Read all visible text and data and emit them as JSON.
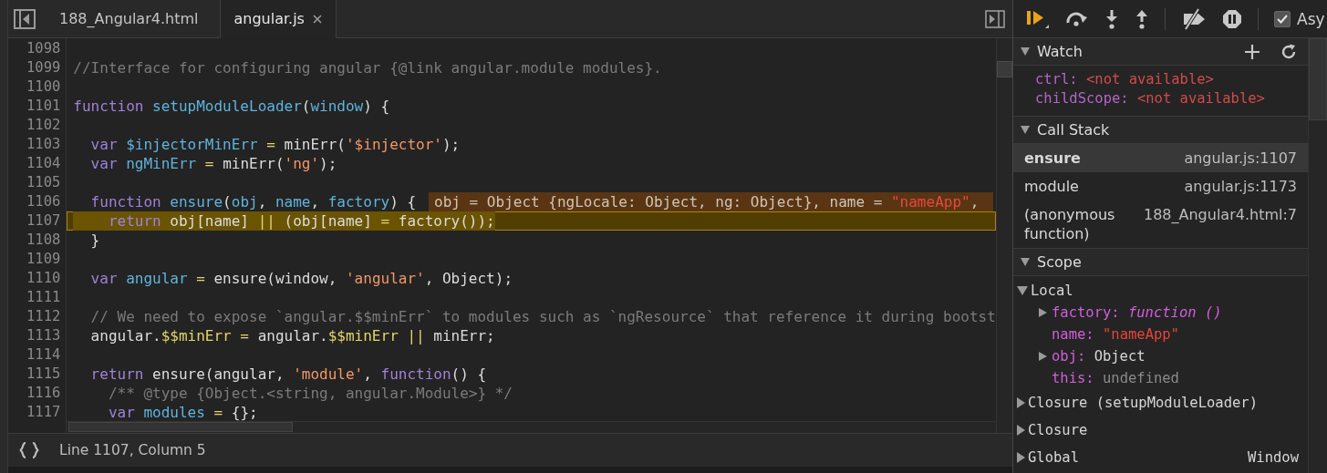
{
  "editor": {
    "tabs": [
      {
        "label": "188_Angular4.html",
        "selected": false,
        "closable": false
      },
      {
        "label": "angular.js",
        "selected": true,
        "closable": true
      }
    ],
    "lines": [
      {
        "number": "1098",
        "current": false
      },
      {
        "number": "1099",
        "current": false,
        "tokens": [
          {
            "kind": "comment",
            "text": "//Interface for configuring angular {@link angular.module modules}."
          }
        ]
      },
      {
        "number": "1100",
        "current": false
      },
      {
        "number": "1101",
        "current": false,
        "tokens": [
          {
            "kind": "keyword",
            "text": "function"
          },
          {
            "kind": "definition",
            "text": " setupModuleLoader"
          },
          {
            "kind": "plain",
            "text": "("
          },
          {
            "kind": "definition",
            "text": "window"
          },
          {
            "kind": "plain",
            "text": ") {"
          }
        ]
      },
      {
        "number": "1102",
        "current": false
      },
      {
        "number": "1103",
        "current": false,
        "tokens": [
          {
            "kind": "keyword",
            "text": "  var"
          },
          {
            "kind": "definition",
            "text": " $injectorMinErr"
          },
          {
            "kind": "operator",
            "text": " = "
          },
          {
            "kind": "plain",
            "text": "minErr("
          },
          {
            "kind": "string",
            "text": "'$injector'"
          },
          {
            "kind": "plain",
            "text": ");"
          }
        ]
      },
      {
        "number": "1104",
        "current": false,
        "tokens": [
          {
            "kind": "keyword",
            "text": "  var"
          },
          {
            "kind": "definition",
            "text": " ngMinErr"
          },
          {
            "kind": "operator",
            "text": " = "
          },
          {
            "kind": "plain",
            "text": "minErr("
          },
          {
            "kind": "string",
            "text": "'ng'"
          },
          {
            "kind": "plain",
            "text": ");"
          }
        ]
      },
      {
        "number": "1105",
        "current": false
      },
      {
        "number": "1106",
        "current": false,
        "tokens": [
          {
            "kind": "keyword",
            "text": "  function"
          },
          {
            "kind": "definition",
            "text": " ensure"
          },
          {
            "kind": "plain",
            "text": "("
          },
          {
            "kind": "definition",
            "text": "obj"
          },
          {
            "kind": "plain",
            "text": ", "
          },
          {
            "kind": "definition",
            "text": "name"
          },
          {
            "kind": "plain",
            "text": ", "
          },
          {
            "kind": "definition",
            "text": "factory"
          },
          {
            "kind": "plain",
            "text": ") {"
          }
        ],
        "inline_value": [
          {
            "kind": "plain",
            "text": "obj = Object {ngLocale: Object, ng: Object}, name = "
          },
          {
            "kind": "value_string",
            "text": "\"nameApp\""
          },
          {
            "kind": "plain",
            "text": ", "
          }
        ]
      },
      {
        "number": "1107",
        "current": true,
        "tokens": [
          {
            "kind": "keyword",
            "text": "    return"
          },
          {
            "kind": "plain",
            "text": " obj[name] "
          },
          {
            "kind": "operator",
            "text": "||"
          },
          {
            "kind": "plain",
            "text": " (obj[name] "
          },
          {
            "kind": "operator",
            "text": "="
          },
          {
            "kind": "plain",
            "text": " factory());"
          }
        ]
      },
      {
        "number": "1108",
        "current": false,
        "tokens": [
          {
            "kind": "plain",
            "text": "  }"
          }
        ]
      },
      {
        "number": "1109",
        "current": false
      },
      {
        "number": "1110",
        "current": false,
        "tokens": [
          {
            "kind": "keyword",
            "text": "  var"
          },
          {
            "kind": "definition",
            "text": " angular"
          },
          {
            "kind": "operator",
            "text": " = "
          },
          {
            "kind": "plain",
            "text": "ensure(window, "
          },
          {
            "kind": "string",
            "text": "'angular'"
          },
          {
            "kind": "plain",
            "text": ", Object);"
          }
        ]
      },
      {
        "number": "1111",
        "current": false
      },
      {
        "number": "1112",
        "current": false,
        "tokens": [
          {
            "kind": "comment",
            "text": "  // We need to expose `angular.$$minErr` to modules such as `ngResource` that reference it during bootst"
          }
        ]
      },
      {
        "number": "1113",
        "current": false,
        "tokens": [
          {
            "kind": "plain",
            "text": "  angular."
          },
          {
            "kind": "property",
            "text": "$$minErr"
          },
          {
            "kind": "operator",
            "text": " = "
          },
          {
            "kind": "plain",
            "text": "angular."
          },
          {
            "kind": "property",
            "text": "$$minErr"
          },
          {
            "kind": "operator",
            "text": " || "
          },
          {
            "kind": "plain",
            "text": "minErr;"
          }
        ]
      },
      {
        "number": "1114",
        "current": false
      },
      {
        "number": "1115",
        "current": false,
        "tokens": [
          {
            "kind": "keyword",
            "text": "  return"
          },
          {
            "kind": "plain",
            "text": " ensure(angular, "
          },
          {
            "kind": "string",
            "text": "'module'"
          },
          {
            "kind": "plain",
            "text": ", "
          },
          {
            "kind": "keyword",
            "text": "function"
          },
          {
            "kind": "plain",
            "text": "() {"
          }
        ]
      },
      {
        "number": "1116",
        "current": false,
        "tokens": [
          {
            "kind": "comment",
            "text": "    /** @type {Object.<string, angular.Module>} */"
          }
        ]
      },
      {
        "number": "1117",
        "current": false,
        "tokens": [
          {
            "kind": "keyword",
            "text": "    var"
          },
          {
            "kind": "definition",
            "text": " modules"
          },
          {
            "kind": "operator",
            "text": " = "
          },
          {
            "kind": "plain",
            "text": "{};"
          }
        ]
      }
    ],
    "status_bar": {
      "position": "Line 1107, Column 5"
    }
  },
  "debugger": {
    "toolbar": {
      "async": {
        "label": "Asy",
        "checked": true
      }
    },
    "watch": {
      "title": "Watch",
      "expanded": true,
      "items": [
        {
          "name": "ctrl:",
          "value": "<not available>"
        },
        {
          "name": "childScope:",
          "value": "<not available>"
        }
      ]
    },
    "call_stack": {
      "title": "Call Stack",
      "expanded": true,
      "frames": [
        {
          "function": "ensure",
          "location": "angular.js:1107",
          "selected": true
        },
        {
          "function": "module",
          "location": "angular.js:1173",
          "selected": false
        },
        {
          "function": "(anonymous function)",
          "location": "188_Angular4.html:7",
          "selected": false
        }
      ]
    },
    "scope": {
      "title": "Scope",
      "expanded": true,
      "tree": [
        {
          "label": "Local",
          "expanded": true,
          "children": [
            {
              "name": "factory:",
              "value": "function ()",
              "kind": "function",
              "expandable": true
            },
            {
              "name": "name:",
              "value": "\"nameApp\"",
              "kind": "string",
              "expandable": false
            },
            {
              "name": "obj:",
              "value": "Object",
              "kind": "object",
              "expandable": true
            },
            {
              "name": "this:",
              "value": "undefined",
              "kind": "undefined",
              "expandable": false
            }
          ]
        },
        {
          "label": "Closure (setupModuleLoader)",
          "expanded": false
        },
        {
          "label": "Closure",
          "expanded": false
        },
        {
          "label": "Global",
          "expanded": false,
          "value": "Window"
        }
      ]
    }
  }
}
